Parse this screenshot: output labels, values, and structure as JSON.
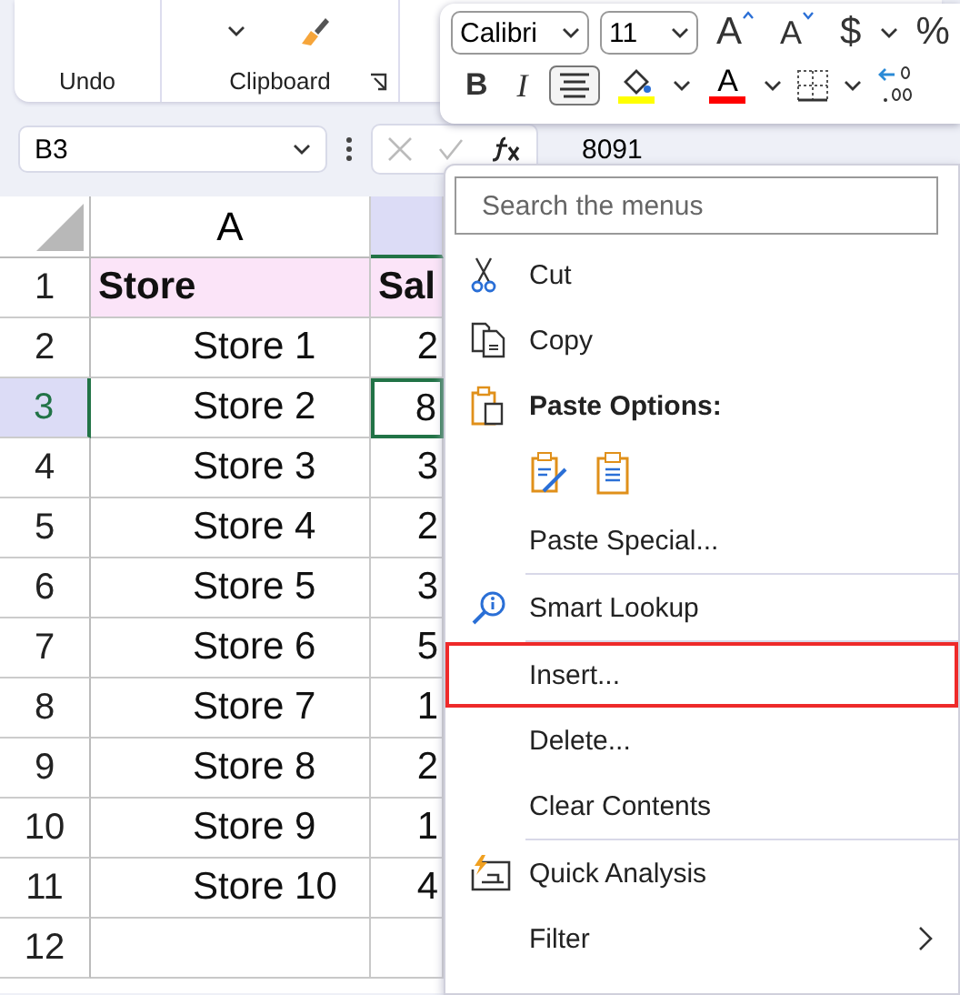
{
  "ribbon": {
    "groups": [
      {
        "label": "Undo",
        "kind": "undo",
        "launcher": false
      },
      {
        "label": "Clipboard",
        "kind": "clipboard",
        "launcher": true
      }
    ]
  },
  "mini_toolbar": {
    "font": "Calibri",
    "size": "11",
    "row1": [
      {
        "kind": "grow-font",
        "label": "A"
      },
      {
        "kind": "shrink-font",
        "label": "A"
      },
      {
        "kind": "text",
        "label": "$"
      },
      {
        "kind": "caret"
      },
      {
        "kind": "text",
        "label": "%"
      }
    ],
    "row2": [
      {
        "kind": "bold",
        "label": "B",
        "on": false
      },
      {
        "kind": "italic",
        "label": "I",
        "on": false
      },
      {
        "kind": "align-center",
        "on": true
      },
      {
        "kind": "fill-color",
        "color": "#ffff00"
      },
      {
        "kind": "caret"
      },
      {
        "kind": "font-color",
        "label": "A",
        "color": "#ff0000"
      },
      {
        "kind": "caret"
      },
      {
        "kind": "borders"
      },
      {
        "kind": "caret"
      },
      {
        "kind": "increase-decimal"
      }
    ]
  },
  "formula_bar": {
    "name_box": "B3",
    "formula": "8091"
  },
  "grid": {
    "columns": [
      {
        "label": "A",
        "selected": false
      },
      {
        "selected": true
      }
    ],
    "rows": [
      {
        "header": "1",
        "kind": "heading",
        "selected": false,
        "cells": [
          "Store",
          "Sal"
        ]
      },
      {
        "header": "2",
        "kind": "data",
        "selected": false,
        "cells": [
          "Store 1",
          "2"
        ]
      },
      {
        "header": "3",
        "kind": "data",
        "selected": true,
        "cells": [
          "Store 2",
          "8"
        ]
      },
      {
        "header": "4",
        "kind": "data",
        "selected": false,
        "cells": [
          "Store 3",
          "3"
        ]
      },
      {
        "header": "5",
        "kind": "data",
        "selected": false,
        "cells": [
          "Store 4",
          "2"
        ]
      },
      {
        "header": "6",
        "kind": "data",
        "selected": false,
        "cells": [
          "Store 5",
          "3"
        ]
      },
      {
        "header": "7",
        "kind": "data",
        "selected": false,
        "cells": [
          "Store 6",
          "5"
        ]
      },
      {
        "header": "8",
        "kind": "data",
        "selected": false,
        "cells": [
          "Store 7",
          "1"
        ]
      },
      {
        "header": "9",
        "kind": "data",
        "selected": false,
        "cells": [
          "Store 8",
          "2"
        ]
      },
      {
        "header": "10",
        "kind": "data",
        "selected": false,
        "cells": [
          "Store 9",
          "1"
        ]
      },
      {
        "header": "11",
        "kind": "data",
        "selected": false,
        "cells": [
          "Store 10",
          "4"
        ]
      },
      {
        "header": "12",
        "kind": "empty",
        "selected": false
      }
    ]
  },
  "context_menu": {
    "search": {
      "placeholder": "Search the menus"
    },
    "items": [
      {
        "kind": "cut",
        "label": "Cut",
        "highlighted": false
      },
      {
        "kind": "copy",
        "label": "Copy",
        "highlighted": false
      },
      {
        "kind": "paste-header",
        "label": "Paste Options:",
        "highlighted": false
      },
      {
        "kind": "paste-options",
        "highlighted": false
      },
      {
        "kind": "plain",
        "label": "Paste Special...",
        "highlighted": false
      },
      {
        "kind": "smart-lookup",
        "label": "Smart Lookup",
        "divider_before": true,
        "highlighted": false
      },
      {
        "kind": "plain",
        "label": "Insert...",
        "divider_before": true,
        "highlighted": true
      },
      {
        "kind": "plain",
        "label": "Delete...",
        "highlighted": false
      },
      {
        "kind": "plain",
        "label": "Clear Contents",
        "highlighted": false
      },
      {
        "kind": "quick-analysis",
        "label": "Quick Analysis",
        "divider_before": true,
        "highlighted": false
      },
      {
        "kind": "plain",
        "label": "Filter",
        "submenu": true,
        "highlighted": false
      }
    ]
  }
}
